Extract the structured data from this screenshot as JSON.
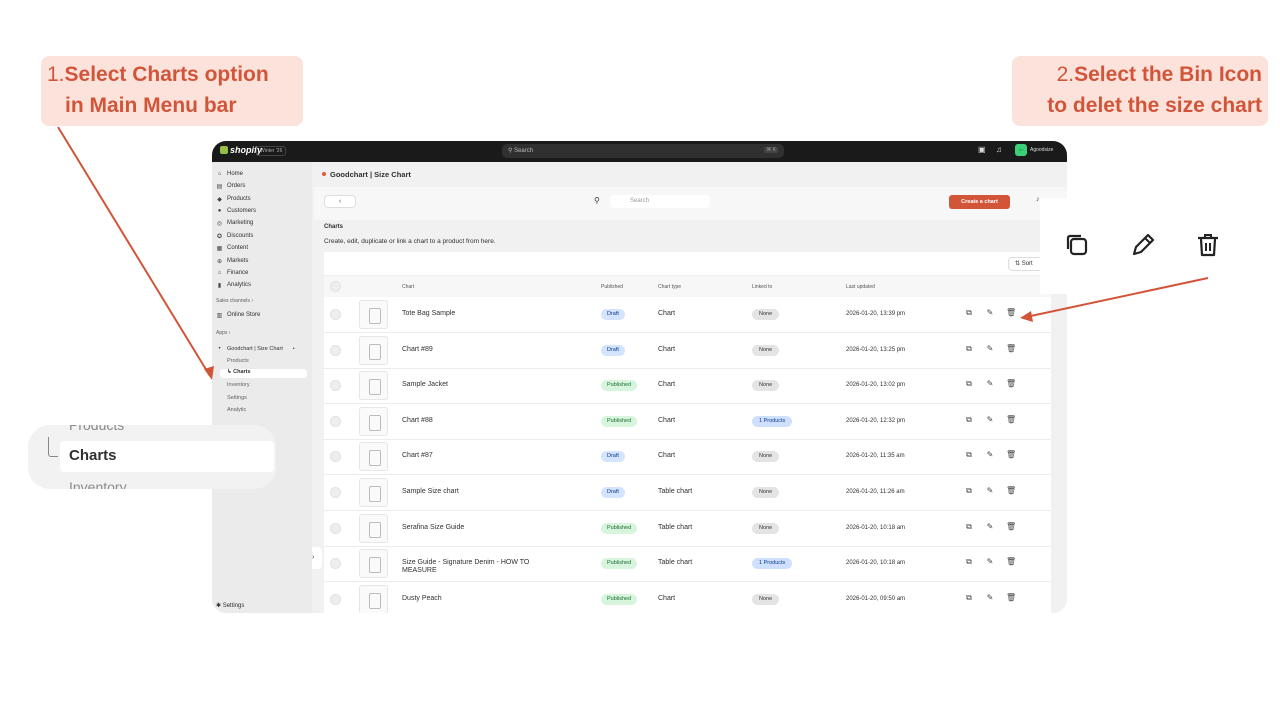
{
  "callouts": {
    "step1": {
      "number": "1.",
      "line1": "Select Charts option",
      "line2": "in Main Menu bar"
    },
    "step2": {
      "number": "2.",
      "line1": "Select the Bin Icon",
      "line2": "to delet the size chart"
    }
  },
  "topbar": {
    "logo": "shopify",
    "edition": "Winter '26",
    "search_placeholder": "Search",
    "shortcut": "⌘ K",
    "avatar_initials": "Ab",
    "store_name": "Agoodsize"
  },
  "sidebar": {
    "items": [
      {
        "label": "Home",
        "icon": "home-icon"
      },
      {
        "label": "Orders",
        "icon": "orders-icon"
      },
      {
        "label": "Products",
        "icon": "tag-icon"
      },
      {
        "label": "Customers",
        "icon": "person-icon"
      },
      {
        "label": "Marketing",
        "icon": "target-icon"
      },
      {
        "label": "Discounts",
        "icon": "discount-icon"
      },
      {
        "label": "Content",
        "icon": "content-icon"
      },
      {
        "label": "Markets",
        "icon": "globe-icon"
      },
      {
        "label": "Finance",
        "icon": "bank-icon"
      },
      {
        "label": "Analytics",
        "icon": "chart-icon"
      }
    ],
    "sales_channels_label": "Sales channels",
    "online_store": "Online Store",
    "apps_label": "Apps",
    "app_name": "Goodchart | Size Chart",
    "app_sub": [
      "Products",
      "Charts",
      "Inventory",
      "Settings",
      "Analytic"
    ],
    "settings": "Settings"
  },
  "main": {
    "app_title": "Goodchart | Size Chart",
    "back": "‹",
    "search_placeholder": "Search",
    "create_button": "Create a chart",
    "heading": "Charts",
    "description": "Create, edit, duplicate or link a chart to a product from here.",
    "sort": "Sort"
  },
  "table": {
    "columns": [
      "Chart",
      "Published",
      "Chart type",
      "Linked to",
      "Last updated"
    ],
    "rows": [
      {
        "name": "Tote Bag Sample",
        "status": "Draft",
        "type": "Chart",
        "linked": "None",
        "updated": "2026-01-20, 13:39 pm"
      },
      {
        "name": "Chart #89",
        "status": "Draft",
        "type": "Chart",
        "linked": "None",
        "updated": "2026-01-20, 13:25 pm"
      },
      {
        "name": "Sample Jacket",
        "status": "Published",
        "type": "Chart",
        "linked": "None",
        "updated": "2026-01-20, 13:02 pm"
      },
      {
        "name": "Chart #88",
        "status": "Published",
        "type": "Chart",
        "linked": "1 Products",
        "updated": "2026-01-20, 12:32 pm"
      },
      {
        "name": "Chart #87",
        "status": "Draft",
        "type": "Chart",
        "linked": "None",
        "updated": "2026-01-20, 11:35 am"
      },
      {
        "name": "Sample Size chart",
        "status": "Draft",
        "type": "Table chart",
        "linked": "None",
        "updated": "2026-01-20, 11:26 am"
      },
      {
        "name": "Serafina Size Guide",
        "status": "Published",
        "type": "Table chart",
        "linked": "None",
        "updated": "2026-01-20, 10:18 am"
      },
      {
        "name": "Size Guide - Signature Denim - HOW TO MEASURE",
        "status": "Published",
        "type": "Table chart",
        "linked": "1 Products",
        "updated": "2026-01-20, 10:18 am"
      },
      {
        "name": "Dusty Peach",
        "status": "Published",
        "type": "Chart",
        "linked": "None",
        "updated": "2026-01-20, 09:50 am"
      }
    ]
  },
  "zoom_left": {
    "above": "Products",
    "active": "Charts",
    "below": "Inventory"
  },
  "colors": {
    "accent": "#d2553a",
    "callout_bg": "#fbe3dc",
    "draft": "#d4e4ff",
    "published": "#d7f5dd"
  }
}
